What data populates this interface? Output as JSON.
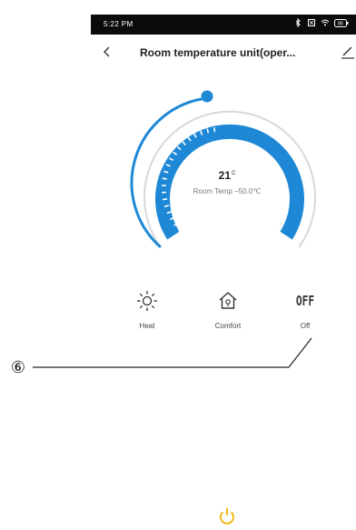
{
  "status_bar": {
    "time": "5:22 PM",
    "icons": [
      "bluetooth-icon",
      "sim-icon",
      "wifi-icon",
      "battery-icon"
    ],
    "battery_level": "85"
  },
  "header": {
    "back_icon": "chevron-left-icon",
    "title": "Room temperature unit(oper...",
    "edit_icon": "pencil-icon"
  },
  "thermostat": {
    "set_temperature": "21",
    "unit": "C",
    "room_temp_label": "Room Temp −50.0℃",
    "accent_color": "#1e88d6",
    "track_color": "#d8d8d8"
  },
  "modes": [
    {
      "icon": "sun-icon",
      "label": "Heat"
    },
    {
      "icon": "home-icon",
      "label": "Comfort"
    },
    {
      "icon": "off-icon",
      "glyph": "OFF",
      "label": "Off"
    }
  ],
  "annotation": {
    "number": "⑥"
  },
  "power": {
    "icon": "power-icon",
    "color": "#f0b400"
  }
}
